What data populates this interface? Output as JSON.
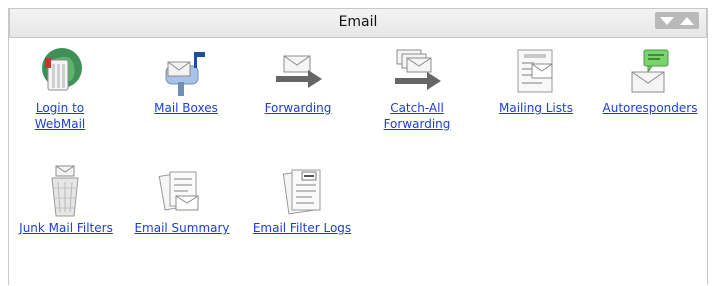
{
  "panel": {
    "title": "Email"
  },
  "items": [
    {
      "label_line1": "Login to",
      "label_line2": "WebMail",
      "icon": "webmail-mailbox-icon"
    },
    {
      "label_line1": "Mail Boxes",
      "label_line2": "",
      "icon": "mailbox-icon"
    },
    {
      "label_line1": "Forwarding",
      "label_line2": "",
      "icon": "forward-envelope-icon"
    },
    {
      "label_line1": "Catch-All",
      "label_line2": "Forwarding",
      "icon": "catch-all-forward-icon"
    },
    {
      "label_line1": "Mailing Lists",
      "label_line2": "",
      "icon": "mailing-list-icon"
    },
    {
      "label_line1": "Autoresponders",
      "label_line2": "",
      "icon": "autoresponder-icon"
    },
    {
      "label_line1": "Junk Mail Filters",
      "label_line2": "",
      "icon": "trash-filter-icon"
    },
    {
      "label_line1": "Email Summary",
      "label_line2": "",
      "icon": "email-summary-icon"
    },
    {
      "label_line1": "Email Filter Logs",
      "label_line2": "",
      "icon": "filter-log-icon"
    }
  ],
  "colors": {
    "link": "#1a3fd8",
    "header_bg": "#eeeeee",
    "toggle_bg": "#b9b9b9"
  }
}
